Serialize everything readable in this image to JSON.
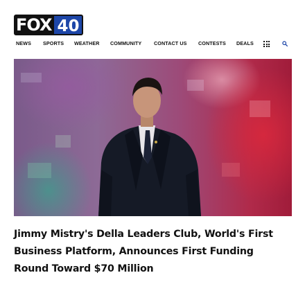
{
  "brand": {
    "name_part": "FOX",
    "number_part": "40"
  },
  "nav": {
    "items": [
      {
        "label": "NEWS"
      },
      {
        "label": "SPORTS"
      },
      {
        "label": "WEATHER"
      },
      {
        "label": "COMMUNITY"
      },
      {
        "label": "CONTACT US"
      },
      {
        "label": "CONTESTS"
      },
      {
        "label": "DEALS"
      }
    ],
    "menu_icon": "grid-icon",
    "search_icon": "search-icon"
  },
  "article": {
    "headline": "Jimmy Mistry's Della Leaders Club, World's First Business Platform, Announces First Funding Round Toward $70 Million"
  },
  "colors": {
    "brand_blue": "#1d46a8",
    "brand_black": "#111111"
  }
}
